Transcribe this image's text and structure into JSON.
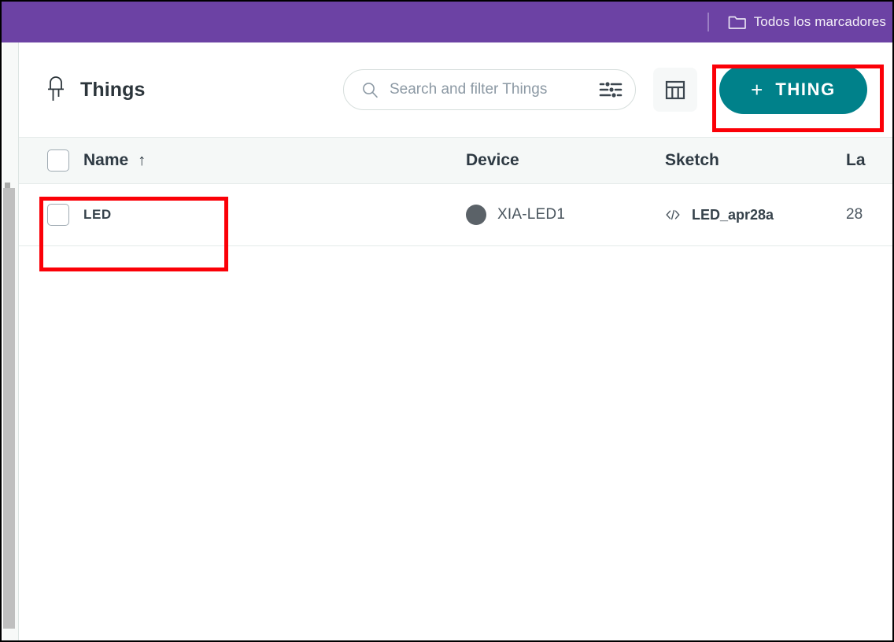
{
  "browser": {
    "bookmark_bar": {
      "items": [
        {
          "label": "Todos los marcadores",
          "icon": "folder-icon"
        }
      ]
    },
    "colors": {
      "bookmark_bar_bg": "#6C42A4"
    }
  },
  "app": {
    "header": {
      "title": "Things",
      "title_icon": "led-diode-icon"
    },
    "search": {
      "placeholder": "Search and filter Things",
      "value": "",
      "search_icon": "search-icon",
      "filter_icon": "filter-sliders-icon"
    },
    "toolbar": {
      "columns_button_icon": "table-columns-icon",
      "add_thing_label": "THING",
      "add_thing_plus": "+",
      "add_thing_color": "#00818A"
    },
    "table": {
      "columns": [
        {
          "key": "name",
          "label": "Name",
          "sorted": true,
          "sort_arrow": "↑"
        },
        {
          "key": "device",
          "label": "Device",
          "sorted": false,
          "sort_arrow": ""
        },
        {
          "key": "sketch",
          "label": "Sketch",
          "sorted": false,
          "sort_arrow": ""
        },
        {
          "key": "last",
          "label": "La",
          "sorted": false,
          "sort_arrow": ""
        }
      ],
      "rows": [
        {
          "name": "LED",
          "device": "XIA-LED1",
          "device_status_color": "#5B6268",
          "sketch": "LED_apr28a",
          "sketch_icon": "code-brackets-icon",
          "last": "28",
          "selected": false
        }
      ],
      "select_all_checked": false
    }
  },
  "annotations": {
    "highlight_color": "#FB0007",
    "boxes": [
      {
        "id": "hl-add-thing",
        "target": "add-thing-button"
      },
      {
        "id": "hl-led-row",
        "target": "table-row-led-name-cell"
      }
    ]
  }
}
